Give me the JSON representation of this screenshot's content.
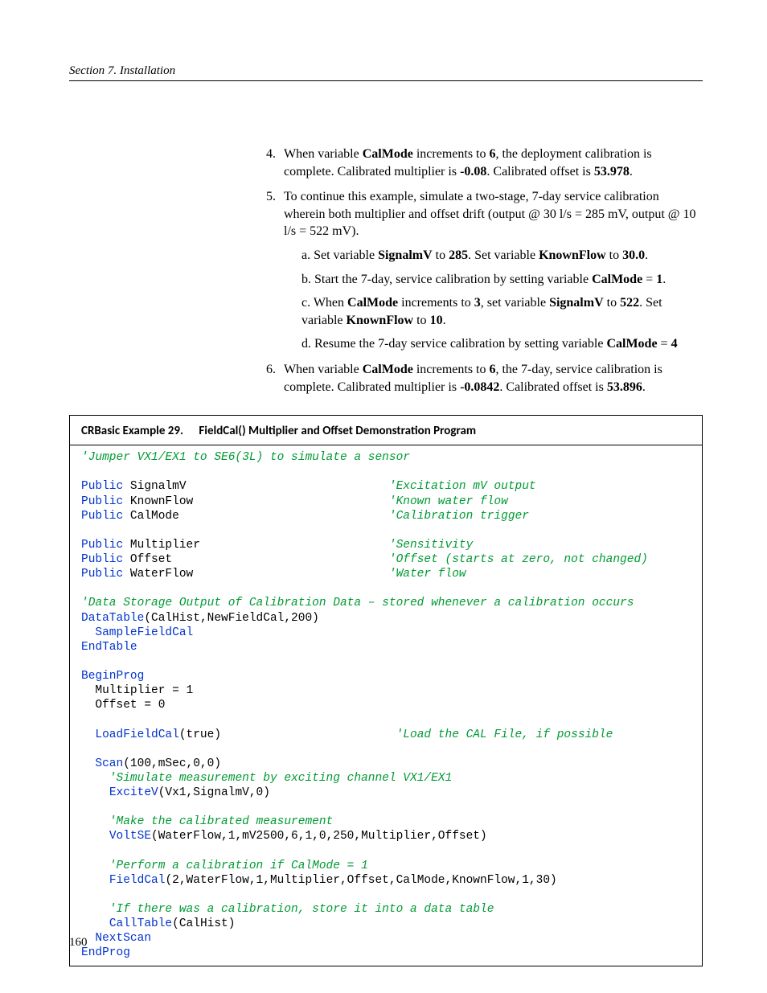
{
  "header": {
    "section": "Section 7.  Installation"
  },
  "steps": {
    "s4": {
      "num": "4.",
      "p1a": "When variable ",
      "b1": "CalMode",
      "p1b": " increments to ",
      "b2": "6",
      "p1c": ", the deployment calibration is complete. Calibrated multiplier is ",
      "b3": "-0.08",
      "p1d": ". Calibrated offset is ",
      "b4": "53.978",
      "p1e": "."
    },
    "s5": {
      "num": "5.",
      "p1": "To continue this example, simulate a two-stage, 7-day service calibration wherein both multiplier and offset drift (output @ 30 l/s = 285 mV, output @ 10 l/s = 522 mV).",
      "a": {
        "pre": "a.  Set variable ",
        "b1": "SignalmV",
        "mid1": " to ",
        "b2": "285",
        "mid2": ". Set variable ",
        "b3": "KnownFlow",
        "mid3": " to ",
        "b4": "30.0",
        "end": "."
      },
      "b": {
        "pre": "b.  Start the 7-day, service calibration by setting variable ",
        "b1": "CalMode",
        "mid": " = ",
        "b2": "1",
        "end": "."
      },
      "c": {
        "pre": "c.  When ",
        "b1": "CalMode",
        "mid1": " increments to ",
        "b2": "3",
        "mid2": ", set variable ",
        "b3": "SignalmV",
        "mid3": " to ",
        "b4": "522",
        "mid4": ". Set variable ",
        "b5": "KnownFlow",
        "mid5": " to ",
        "b6": "10",
        "end": "."
      },
      "d": {
        "pre": "d.  Resume the 7-day service calibration by setting variable ",
        "b1": "CalMode",
        "mid": " = ",
        "b2": "4"
      }
    },
    "s6": {
      "num": "6.",
      "p1a": "When variable ",
      "b1": "CalMode",
      "p1b": " increments to ",
      "b2": "6",
      "p1c": ", the 7-day, service calibration is complete. Calibrated multiplier is ",
      "b3": "-0.0842",
      "p1d": ". Calibrated offset is ",
      "b4": "53.896",
      "p1e": "."
    }
  },
  "example": {
    "label": "CRBasic Example 29.",
    "title": "FieldCal() Multiplier and Offset Demonstration Program"
  },
  "code": {
    "c01": "'Jumper VX1/EX1 to SE6(3L) to simulate a sensor",
    "kPublic": "Public",
    "vSignalmV": " SignalmV",
    "cSignalmV": "'Excitation mV output",
    "vKnownFlow": " KnownFlow",
    "cKnownFlow": "'Known water flow",
    "vCalMode": " CalMode",
    "cCalMode": "'Calibration trigger",
    "vMultiplier": " Multiplier",
    "cMultiplier": "'Sensitivity",
    "vOffset": " Offset",
    "cOffset": "'Offset (starts at zero, not changed)",
    "vWaterFlow": " WaterFlow",
    "cWaterFlow": "'Water flow",
    "cData": "'Data Storage Output of Calibration Data ‒ stored whenever a calibration occurs",
    "kDataTable": "DataTable",
    "aDataTable": "(CalHist,NewFieldCal,200)",
    "kSampleFieldCal": "SampleFieldCal",
    "kEndTable": "EndTable",
    "kBeginProg": "BeginProg",
    "lMult": "  Multiplier = 1",
    "lOff": "  Offset = 0",
    "kLoadFieldCal": "LoadFieldCal",
    "aLoadFieldCal": "(true)",
    "cLoad": "'Load the CAL File, if possible",
    "kScan": "Scan",
    "aScan": "(100,mSec,0,0)",
    "cSim": "'Simulate measurement by exciting channel VX1/EX1",
    "kExciteV": "ExciteV",
    "aExciteV": "(Vx1,SignalmV,0)",
    "cMake": "'Make the calibrated measurement",
    "kVoltSE": "VoltSE",
    "aVoltSE": "(WaterFlow,1,mV2500,6,1,0,250,Multiplier,Offset)",
    "cPerf": "'Perform a calibration if CalMode = 1",
    "kFieldCal": "FieldCal",
    "aFieldCal": "(2,WaterFlow,1,Multiplier,Offset,CalMode,KnownFlow,1,30)",
    "cIf": "'If there was a calibration, store it into a data table",
    "kCallTable": "CallTable",
    "aCallTable": "(CalHist)",
    "kNextScan": "NextScan",
    "kEndProg": "EndProg"
  },
  "pagenum": "160"
}
